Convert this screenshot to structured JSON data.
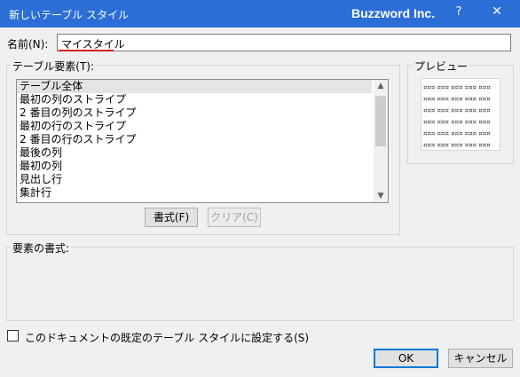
{
  "window": {
    "title": "新しいテーブル スタイル",
    "brand": "Buzzword Inc.",
    "help_label": "?",
    "close_label": "✕"
  },
  "name_field": {
    "label": "名前(N):",
    "value": "マイスタイル"
  },
  "elements_group": {
    "label": "テーブル要素(T):",
    "items": [
      "テーブル全体",
      "最初の列のストライプ",
      "2 番目の列のストライプ",
      "最初の行のストライプ",
      "2 番目の行のストライプ",
      "最後の列",
      "最初の列",
      "見出し行",
      "集計行"
    ],
    "selected_index": 0,
    "format_button": "書式(F)",
    "clear_button": "クリア(C)"
  },
  "preview": {
    "label": "プレビュー",
    "rows": [
      "¤¤¤ ¤¤¤ ¤¤¤ ¤¤¤ ¤¤¤",
      "¤¤¤ ¤¤¤ ¤¤¤ ¤¤¤ ¤¤¤",
      "¤¤¤ ¤¤¤ ¤¤¤ ¤¤¤ ¤¤¤",
      "¤¤¤ ¤¤¤ ¤¤¤ ¤¤¤ ¤¤¤",
      "¤¤¤ ¤¤¤ ¤¤¤ ¤¤¤ ¤¤¤",
      "¤¤¤ ¤¤¤ ¤¤¤ ¤¤¤ ¤¤¤"
    ]
  },
  "format_group": {
    "label": "要素の書式:"
  },
  "default_checkbox": {
    "label": "このドキュメントの既定のテーブル スタイルに設定する(S)",
    "checked": false
  },
  "footer": {
    "ok_label": "OK",
    "cancel_label": "キャンセル"
  }
}
